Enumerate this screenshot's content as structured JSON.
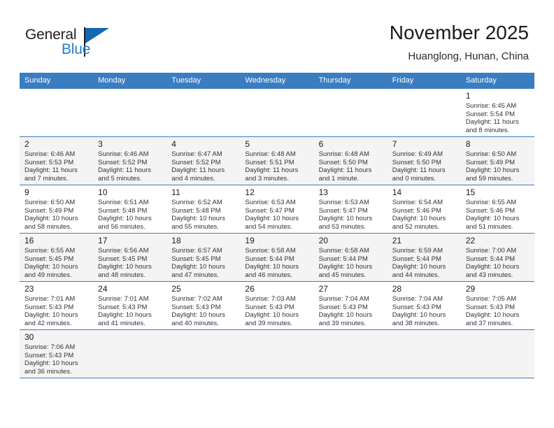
{
  "brand": {
    "name_primary": "General",
    "name_secondary": "Blue",
    "flag_icon": "blue-flag-triangle-icon",
    "accent_color": "#1567b2"
  },
  "header": {
    "title": "November 2025",
    "subtitle": "Huanglong, Hunan, China"
  },
  "calendar": {
    "header_bg_color": "#3a7dc0",
    "weekdays": [
      "Sunday",
      "Monday",
      "Tuesday",
      "Wednesday",
      "Thursday",
      "Friday",
      "Saturday"
    ],
    "weeks": [
      [
        {
          "day": "",
          "sunrise": "",
          "sunset": "",
          "daylight_line1": "",
          "daylight_line2": ""
        },
        {
          "day": "",
          "sunrise": "",
          "sunset": "",
          "daylight_line1": "",
          "daylight_line2": ""
        },
        {
          "day": "",
          "sunrise": "",
          "sunset": "",
          "daylight_line1": "",
          "daylight_line2": ""
        },
        {
          "day": "",
          "sunrise": "",
          "sunset": "",
          "daylight_line1": "",
          "daylight_line2": ""
        },
        {
          "day": "",
          "sunrise": "",
          "sunset": "",
          "daylight_line1": "",
          "daylight_line2": ""
        },
        {
          "day": "",
          "sunrise": "",
          "sunset": "",
          "daylight_line1": "",
          "daylight_line2": ""
        },
        {
          "day": "1",
          "sunrise": "Sunrise: 6:45 AM",
          "sunset": "Sunset: 5:54 PM",
          "daylight_line1": "Daylight: 11 hours",
          "daylight_line2": "and 8 minutes."
        }
      ],
      [
        {
          "day": "2",
          "sunrise": "Sunrise: 6:46 AM",
          "sunset": "Sunset: 5:53 PM",
          "daylight_line1": "Daylight: 11 hours",
          "daylight_line2": "and 7 minutes."
        },
        {
          "day": "3",
          "sunrise": "Sunrise: 6:46 AM",
          "sunset": "Sunset: 5:52 PM",
          "daylight_line1": "Daylight: 11 hours",
          "daylight_line2": "and 5 minutes."
        },
        {
          "day": "4",
          "sunrise": "Sunrise: 6:47 AM",
          "sunset": "Sunset: 5:52 PM",
          "daylight_line1": "Daylight: 11 hours",
          "daylight_line2": "and 4 minutes."
        },
        {
          "day": "5",
          "sunrise": "Sunrise: 6:48 AM",
          "sunset": "Sunset: 5:51 PM",
          "daylight_line1": "Daylight: 11 hours",
          "daylight_line2": "and 3 minutes."
        },
        {
          "day": "6",
          "sunrise": "Sunrise: 6:48 AM",
          "sunset": "Sunset: 5:50 PM",
          "daylight_line1": "Daylight: 11 hours",
          "daylight_line2": "and 1 minute."
        },
        {
          "day": "7",
          "sunrise": "Sunrise: 6:49 AM",
          "sunset": "Sunset: 5:50 PM",
          "daylight_line1": "Daylight: 11 hours",
          "daylight_line2": "and 0 minutes."
        },
        {
          "day": "8",
          "sunrise": "Sunrise: 6:50 AM",
          "sunset": "Sunset: 5:49 PM",
          "daylight_line1": "Daylight: 10 hours",
          "daylight_line2": "and 59 minutes."
        }
      ],
      [
        {
          "day": "9",
          "sunrise": "Sunrise: 6:50 AM",
          "sunset": "Sunset: 5:49 PM",
          "daylight_line1": "Daylight: 10 hours",
          "daylight_line2": "and 58 minutes."
        },
        {
          "day": "10",
          "sunrise": "Sunrise: 6:51 AM",
          "sunset": "Sunset: 5:48 PM",
          "daylight_line1": "Daylight: 10 hours",
          "daylight_line2": "and 56 minutes."
        },
        {
          "day": "11",
          "sunrise": "Sunrise: 6:52 AM",
          "sunset": "Sunset: 5:48 PM",
          "daylight_line1": "Daylight: 10 hours",
          "daylight_line2": "and 55 minutes."
        },
        {
          "day": "12",
          "sunrise": "Sunrise: 6:53 AM",
          "sunset": "Sunset: 5:47 PM",
          "daylight_line1": "Daylight: 10 hours",
          "daylight_line2": "and 54 minutes."
        },
        {
          "day": "13",
          "sunrise": "Sunrise: 6:53 AM",
          "sunset": "Sunset: 5:47 PM",
          "daylight_line1": "Daylight: 10 hours",
          "daylight_line2": "and 53 minutes."
        },
        {
          "day": "14",
          "sunrise": "Sunrise: 6:54 AM",
          "sunset": "Sunset: 5:46 PM",
          "daylight_line1": "Daylight: 10 hours",
          "daylight_line2": "and 52 minutes."
        },
        {
          "day": "15",
          "sunrise": "Sunrise: 6:55 AM",
          "sunset": "Sunset: 5:46 PM",
          "daylight_line1": "Daylight: 10 hours",
          "daylight_line2": "and 51 minutes."
        }
      ],
      [
        {
          "day": "16",
          "sunrise": "Sunrise: 6:55 AM",
          "sunset": "Sunset: 5:45 PM",
          "daylight_line1": "Daylight: 10 hours",
          "daylight_line2": "and 49 minutes."
        },
        {
          "day": "17",
          "sunrise": "Sunrise: 6:56 AM",
          "sunset": "Sunset: 5:45 PM",
          "daylight_line1": "Daylight: 10 hours",
          "daylight_line2": "and 48 minutes."
        },
        {
          "day": "18",
          "sunrise": "Sunrise: 6:57 AM",
          "sunset": "Sunset: 5:45 PM",
          "daylight_line1": "Daylight: 10 hours",
          "daylight_line2": "and 47 minutes."
        },
        {
          "day": "19",
          "sunrise": "Sunrise: 6:58 AM",
          "sunset": "Sunset: 5:44 PM",
          "daylight_line1": "Daylight: 10 hours",
          "daylight_line2": "and 46 minutes."
        },
        {
          "day": "20",
          "sunrise": "Sunrise: 6:58 AM",
          "sunset": "Sunset: 5:44 PM",
          "daylight_line1": "Daylight: 10 hours",
          "daylight_line2": "and 45 minutes."
        },
        {
          "day": "21",
          "sunrise": "Sunrise: 6:59 AM",
          "sunset": "Sunset: 5:44 PM",
          "daylight_line1": "Daylight: 10 hours",
          "daylight_line2": "and 44 minutes."
        },
        {
          "day": "22",
          "sunrise": "Sunrise: 7:00 AM",
          "sunset": "Sunset: 5:44 PM",
          "daylight_line1": "Daylight: 10 hours",
          "daylight_line2": "and 43 minutes."
        }
      ],
      [
        {
          "day": "23",
          "sunrise": "Sunrise: 7:01 AM",
          "sunset": "Sunset: 5:43 PM",
          "daylight_line1": "Daylight: 10 hours",
          "daylight_line2": "and 42 minutes."
        },
        {
          "day": "24",
          "sunrise": "Sunrise: 7:01 AM",
          "sunset": "Sunset: 5:43 PM",
          "daylight_line1": "Daylight: 10 hours",
          "daylight_line2": "and 41 minutes."
        },
        {
          "day": "25",
          "sunrise": "Sunrise: 7:02 AM",
          "sunset": "Sunset: 5:43 PM",
          "daylight_line1": "Daylight: 10 hours",
          "daylight_line2": "and 40 minutes."
        },
        {
          "day": "26",
          "sunrise": "Sunrise: 7:03 AM",
          "sunset": "Sunset: 5:43 PM",
          "daylight_line1": "Daylight: 10 hours",
          "daylight_line2": "and 39 minutes."
        },
        {
          "day": "27",
          "sunrise": "Sunrise: 7:04 AM",
          "sunset": "Sunset: 5:43 PM",
          "daylight_line1": "Daylight: 10 hours",
          "daylight_line2": "and 39 minutes."
        },
        {
          "day": "28",
          "sunrise": "Sunrise: 7:04 AM",
          "sunset": "Sunset: 5:43 PM",
          "daylight_line1": "Daylight: 10 hours",
          "daylight_line2": "and 38 minutes."
        },
        {
          "day": "29",
          "sunrise": "Sunrise: 7:05 AM",
          "sunset": "Sunset: 5:43 PM",
          "daylight_line1": "Daylight: 10 hours",
          "daylight_line2": "and 37 minutes."
        }
      ],
      [
        {
          "day": "30",
          "sunrise": "Sunrise: 7:06 AM",
          "sunset": "Sunset: 5:43 PM",
          "daylight_line1": "Daylight: 10 hours",
          "daylight_line2": "and 36 minutes."
        },
        {
          "day": "",
          "sunrise": "",
          "sunset": "",
          "daylight_line1": "",
          "daylight_line2": ""
        },
        {
          "day": "",
          "sunrise": "",
          "sunset": "",
          "daylight_line1": "",
          "daylight_line2": ""
        },
        {
          "day": "",
          "sunrise": "",
          "sunset": "",
          "daylight_line1": "",
          "daylight_line2": ""
        },
        {
          "day": "",
          "sunrise": "",
          "sunset": "",
          "daylight_line1": "",
          "daylight_line2": ""
        },
        {
          "day": "",
          "sunrise": "",
          "sunset": "",
          "daylight_line1": "",
          "daylight_line2": ""
        },
        {
          "day": "",
          "sunrise": "",
          "sunset": "",
          "daylight_line1": "",
          "daylight_line2": ""
        }
      ]
    ]
  }
}
